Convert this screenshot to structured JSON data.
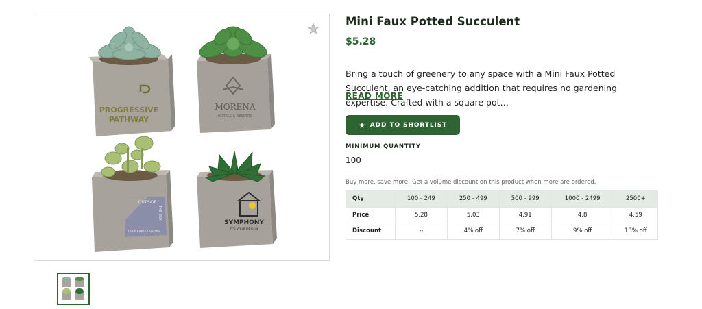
{
  "product": {
    "title": "Mini Faux Potted Succulent",
    "price": "$5.28",
    "description": "Bring a touch of greenery to any space with a Mini Faux Potted Succulent, an eye-catching addition that requires no gardening expertise. Crafted with a square pot…",
    "read_more_label": "READ MORE",
    "shortlist_label": "ADD TO SHORTLIST",
    "favorite_icon": "star-icon"
  },
  "gallery": {
    "main_image": {
      "pots": [
        {
          "plant": "echeveria",
          "logo_line1": "PROGRESSIVE",
          "logo_line2": "PATHWAY"
        },
        {
          "plant": "rosette",
          "logo_line1": "MORENA",
          "logo_line2": "HOTELS & RESORTS"
        },
        {
          "plant": "sedum",
          "logo_line1": "OUTSIDE",
          "logo_line2": "THE BOX",
          "logo_line3": "DEFY EXPECTATIONS"
        },
        {
          "plant": "aloe",
          "logo_line1": "SYMPHONY",
          "logo_line2": "IT'S YOUR DESIGN"
        }
      ]
    },
    "thumbnails": [
      {
        "selected": true
      }
    ]
  },
  "quantity": {
    "label": "MINIMUM QUANTITY",
    "value": "100",
    "volume_note": "Buy more, save more! Get a volume discount on this product when more are ordered."
  },
  "pricing_table": {
    "header": [
      "Qty",
      "100 - 249",
      "250 - 499",
      "500 - 999",
      "1000 - 2499",
      "2500+"
    ],
    "rows": [
      [
        "Price",
        "5.28",
        "5.03",
        "4.91",
        "4.8",
        "4.59"
      ],
      [
        "Discount",
        "--",
        "4% off",
        "7% off",
        "9% off",
        "13% off"
      ]
    ]
  },
  "colors": {
    "brand_green": "#2e6431",
    "table_header_bg": "#e4ebe4"
  }
}
